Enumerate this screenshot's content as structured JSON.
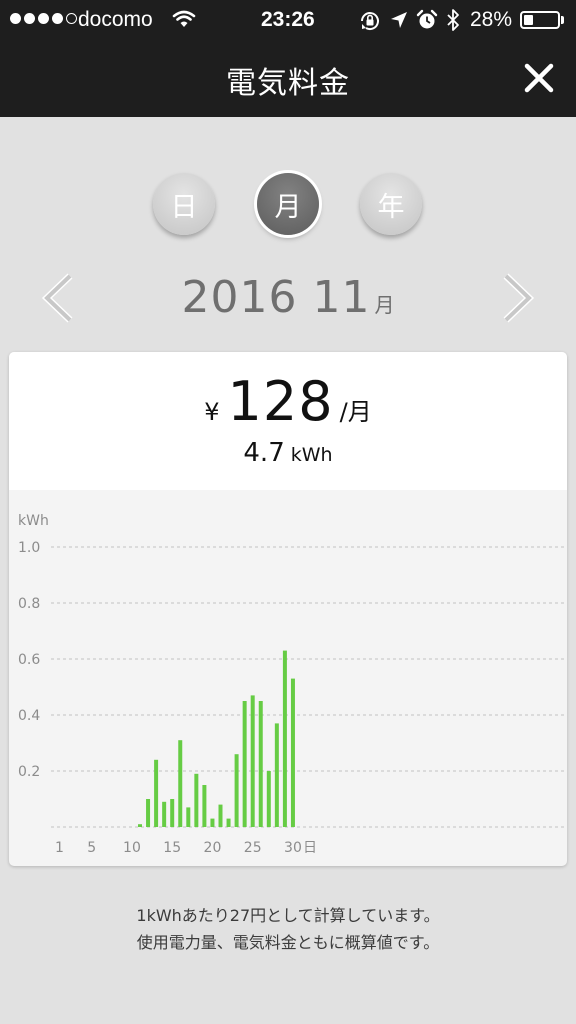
{
  "status_bar": {
    "carrier": "docomo",
    "time": "23:26",
    "battery_percent": "28%",
    "battery_level": 0.28,
    "signal_bars": 4,
    "signal_max": 5,
    "icons": [
      "wifi-icon",
      "orientation-lock-icon",
      "location-arrow-icon",
      "alarm-icon",
      "bluetooth-icon",
      "battery-icon"
    ]
  },
  "nav": {
    "title": "電気料金",
    "close_icon": "close-icon"
  },
  "period_tabs": [
    {
      "label": "日",
      "selected": false
    },
    {
      "label": "月",
      "selected": true
    },
    {
      "label": "年",
      "selected": false
    }
  ],
  "date": {
    "value": "2016 11",
    "unit": "月"
  },
  "summary": {
    "currency": "¥",
    "price": "128",
    "price_unit": "/月",
    "energy": "4.7",
    "energy_unit": "kWh"
  },
  "chart_data": {
    "type": "bar",
    "ylabel": "kWh",
    "ylim": [
      0,
      1.0
    ],
    "yticks": [
      "1.0",
      "0.8",
      "0.6",
      "0.4",
      "0.2"
    ],
    "xtick_labels": [
      "1",
      "5",
      "10",
      "15",
      "20",
      "25",
      "30"
    ],
    "x_unit": "日",
    "grid": true,
    "color": "#66cc44",
    "categories": [
      1,
      2,
      3,
      4,
      5,
      6,
      7,
      8,
      9,
      10,
      11,
      12,
      13,
      14,
      15,
      16,
      17,
      18,
      19,
      20,
      21,
      22,
      23,
      24,
      25,
      26,
      27,
      28,
      29,
      30
    ],
    "values": [
      0,
      0,
      0,
      0,
      0,
      0,
      0,
      0,
      0,
      0,
      0.01,
      0.1,
      0.24,
      0.09,
      0.1,
      0.31,
      0.07,
      0.19,
      0.15,
      0.03,
      0.08,
      0.03,
      0.26,
      0.45,
      0.47,
      0.45,
      0.2,
      0.37,
      0.63,
      0.53
    ]
  },
  "footer": {
    "line1": "1kWhあたり27円として計算しています。",
    "line2": "使用電力量、電気料金ともに概算値です。"
  }
}
